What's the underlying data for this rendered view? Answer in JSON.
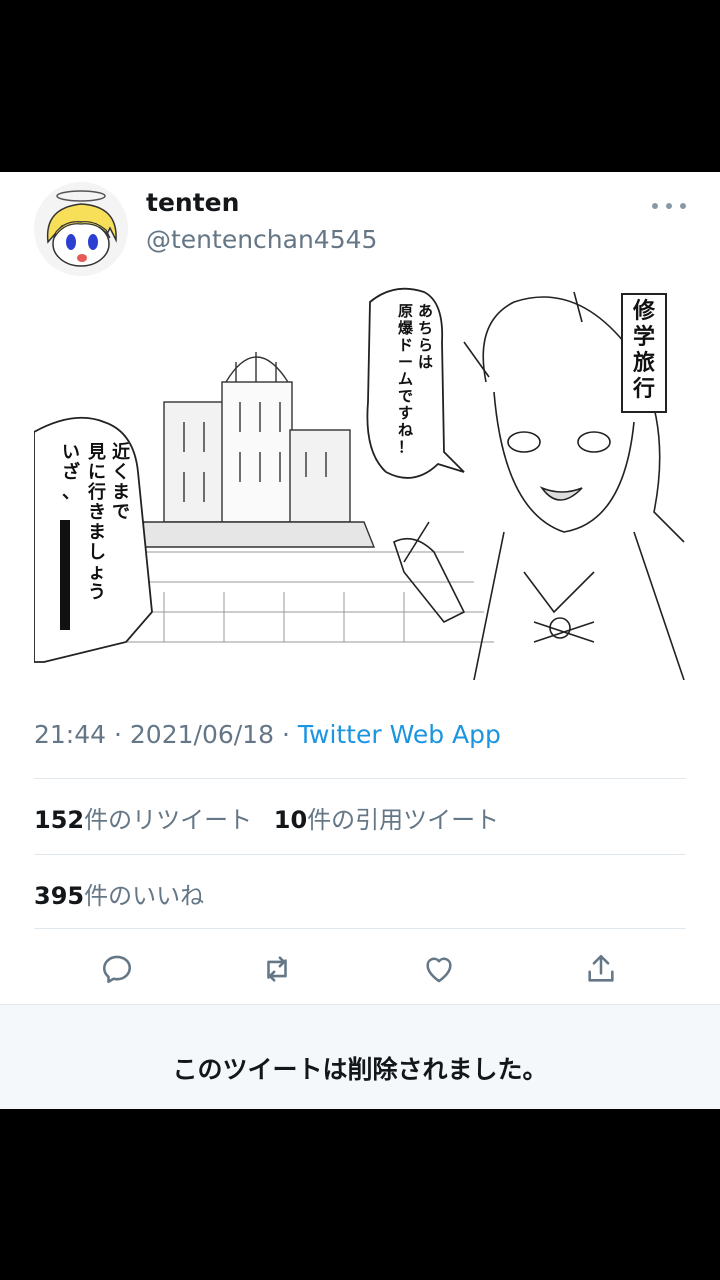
{
  "tweet": {
    "display_name": "tenten",
    "handle": "@tentenchan4545",
    "more_icon": "more-horizontal-icon",
    "image": {
      "caption_right": "修学旅行",
      "speech_center": [
        "あちらは",
        "原爆ドームですね！"
      ],
      "speech_left": [
        "近くまで",
        "見に行きましょう",
        "いざ、"
      ]
    },
    "time": "21:44",
    "separator": "·",
    "date": "2021/06/18",
    "source": "Twitter Web App",
    "retweet_count": "152",
    "retweet_label": "件のリツイート",
    "quote_count": "10",
    "quote_label": "件の引用ツイート",
    "like_count": "395",
    "like_label": "件のいいね",
    "actions": [
      "reply-icon",
      "retweet-icon",
      "like-icon",
      "share-icon"
    ]
  },
  "deleted_notice": "このツイートは削除されました。",
  "colors": {
    "background": "#000000",
    "card": "#ffffff",
    "secondary_text": "#657786",
    "link": "#1b95e0",
    "divider": "#e1e8ed",
    "deleted_bg": "#f5f8fa"
  }
}
